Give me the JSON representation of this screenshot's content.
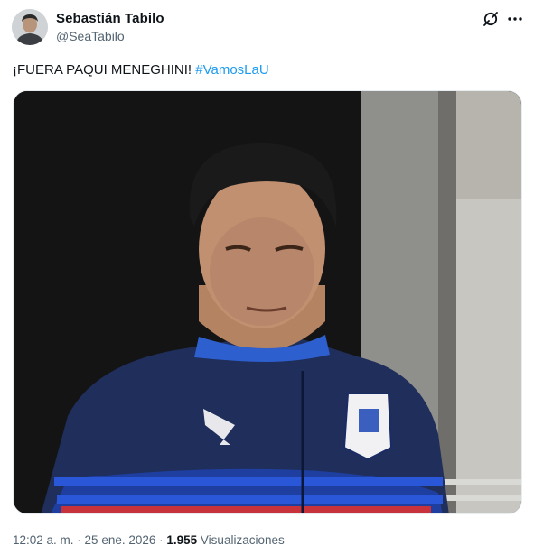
{
  "author": {
    "name": "Sebastián Tabilo",
    "handle": "@SeaTabilo"
  },
  "tweet": {
    "text": "¡FUERA PAQUI MENEGHINI! ",
    "hashtag": "#VamosLaU"
  },
  "meta": {
    "time": "12:02 a. m.",
    "separator1": " · ",
    "date": "25 ene. 2026",
    "separator2": " · ",
    "views_count": "1.955",
    "views_label": " Visualizaciones"
  },
  "icons": {
    "grok": "grok-icon",
    "more": "more-icon"
  },
  "colors": {
    "link": "#1d9bf0",
    "secondary_text": "#536471",
    "primary_text": "#0f1419"
  }
}
